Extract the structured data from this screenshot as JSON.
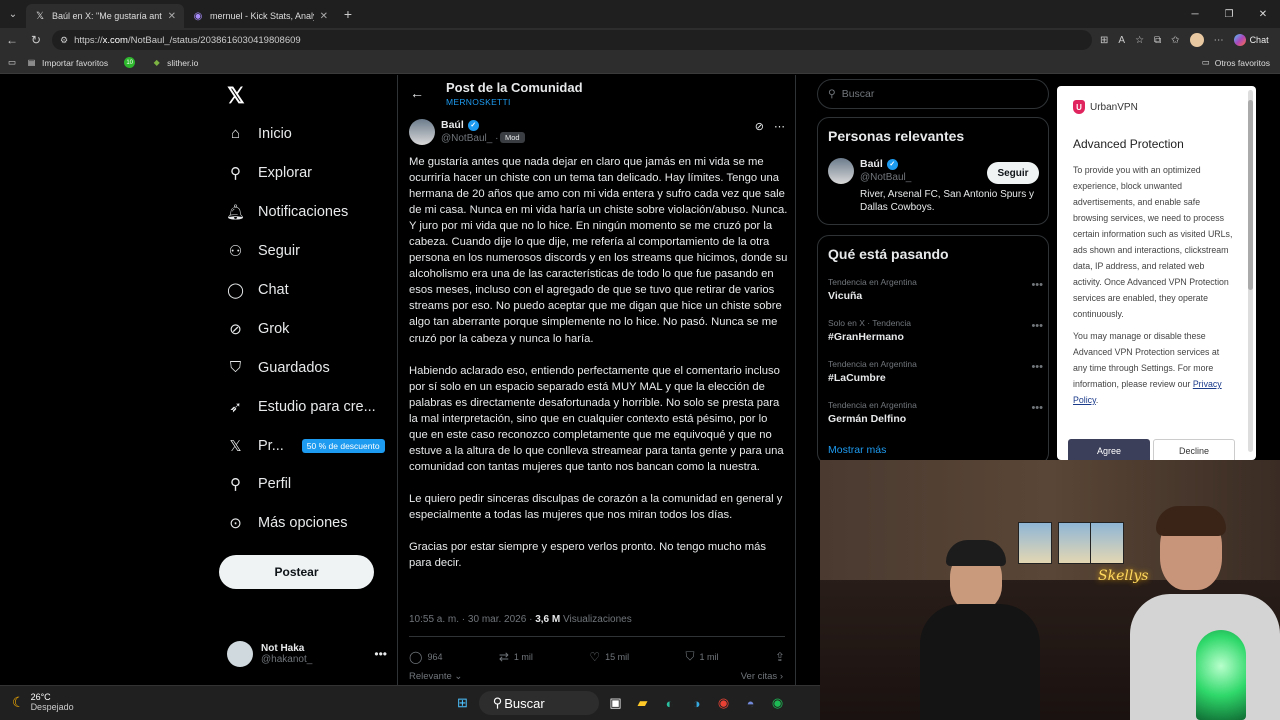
{
  "browser": {
    "tabs": [
      {
        "title": "Baúl en X: \"Me gustaría antes que",
        "icon": "x-logo-icon",
        "active": true
      },
      {
        "title": "mernuel - Kick Stats, Analytics and",
        "icon": "stats-site-icon",
        "active": false
      }
    ],
    "url_prefix": "https://",
    "url_host": "x.com",
    "url_path": "/NotBaul_/status/2038616030419808609",
    "chat_label": "Chat",
    "bookmarks": [
      {
        "label": "Importar favoritos"
      },
      {
        "label": "",
        "badge": "10"
      },
      {
        "label": "slither.io"
      }
    ],
    "other_bookmarks": "Otros favoritos"
  },
  "nav": {
    "items": [
      {
        "label": "Inicio",
        "icon": "home-icon"
      },
      {
        "label": "Explorar",
        "icon": "search-icon"
      },
      {
        "label": "Notificaciones",
        "icon": "bell-icon"
      },
      {
        "label": "Seguir",
        "icon": "add-person-icon"
      },
      {
        "label": "Chat",
        "icon": "chat-bubble-icon"
      },
      {
        "label": "Grok",
        "icon": "grok-icon"
      },
      {
        "label": "Guardados",
        "icon": "bookmark-icon"
      },
      {
        "label": "Estudio para cre...",
        "icon": "rocket-icon"
      },
      {
        "label": "Pr...",
        "icon": "x-logo-icon"
      },
      {
        "label": "Perfil",
        "icon": "person-icon"
      },
      {
        "label": "Más opciones",
        "icon": "more-circle-icon"
      }
    ],
    "promo_badge": "50 % de descuento",
    "post_button": "Postear",
    "account": {
      "name": "Not Haka",
      "handle": "@hakanot_"
    }
  },
  "post": {
    "header_title": "Post de la Comunidad",
    "community": "MERNOSKETTI",
    "author_name": "Baúl",
    "author_handle": "@NotBaul_ ·",
    "mod_badge": "Mod",
    "paragraphs": [
      "Me gustaría antes que nada dejar en claro que jamás en mi vida se me ocurriría hacer un chiste con un tema tan delicado. Hay límites. Tengo una hermana de 20 años que amo con mi vida entera y sufro cada vez que sale de mi casa. Nunca en mi vida haría un chiste sobre violación/abuso. Nunca. Y juro por mi vida que no lo hice. En ningún momento se me cruzó por la cabeza. Cuando dije lo que dije, me refería al comportamiento de la otra persona en los numerosos discords y en los streams que hicimos, donde su alcoholismo era una de las características de todo lo que fue pasando en esos meses, incluso con el agregado de que se tuvo que retirar de varios streams por eso. No puedo aceptar que me digan que hice un chiste sobre algo tan aberrante porque simplemente no lo hice. No pasó. Nunca se me cruzó por la cabeza y nunca lo haría.",
      "Habiendo aclarado eso, entiendo perfectamente que el comentario incluso por sí solo en un espacio separado está MUY MAL y que la elección de palabras es directamente desafortunada y horrible. No solo se presta para la mal interpretación, sino que en cualquier contexto está pésimo, por lo que en este caso reconozco completamente que me equivoqué y que no estuve a la altura de lo que conlleva streamear para tanta gente y para una comunidad con tantas mujeres que tanto nos bancan como la nuestra.",
      "Le quiero pedir sinceras disculpas de corazón a la comunidad en general y especialmente a todas las mujeres que nos miran todos los días.",
      "Gracias por estar siempre y espero verlos pronto. No tengo mucho más para decir."
    ],
    "timestamp": "10:55 a. m. · 30 mar. 2026 ·",
    "views_count": "3,6 M",
    "views_label": "Visualizaciones",
    "replies": "964",
    "reposts": "1 mil",
    "likes": "15 mil",
    "bookmarks": "1 mil",
    "sort_label": "Relevante",
    "quotes_label": "Ver citas"
  },
  "sidebar": {
    "search_placeholder": "Buscar",
    "relevant_title": "Personas relevantes",
    "relevant_person": {
      "name": "Baúl",
      "handle": "@NotBaul_",
      "bio": "River, Arsenal FC, San Antonio Spurs y Dallas Cowboys.",
      "follow_label": "Seguir"
    },
    "trends_title": "Qué está pasando",
    "trends": [
      {
        "context": "Tendencia en Argentina",
        "topic": "Vicuña"
      },
      {
        "context": "Solo en X · Tendencia",
        "topic": "#GranHermano"
      },
      {
        "context": "Tendencia en Argentina",
        "topic": "#LaCumbre"
      },
      {
        "context": "Tendencia en Argentina",
        "topic": "Germán Delfino"
      }
    ],
    "show_more": "Mostrar más"
  },
  "vpn": {
    "brand": "UrbanVPN",
    "title": "Advanced Protection",
    "text1": "To provide you with an optimized experience, block unwanted advertisements, and enable safe browsing services, we need to process certain information such as visited URLs, ads shown and interactions, clickstream data, IP address, and related web activity. Once Advanced VPN Protection services are enabled, they operate continuously.",
    "text2": "You may manage or disable these Advanced VPN Protection services at any time through Settings. For more information, please review our",
    "privacy_link": "Privacy Policy",
    "agree": "Agree",
    "decline": "Decline"
  },
  "webcam": {
    "neon_sign": "Skellys"
  },
  "taskbar": {
    "temperature": "26°C",
    "condition": "Despejado",
    "search": "Buscar"
  }
}
